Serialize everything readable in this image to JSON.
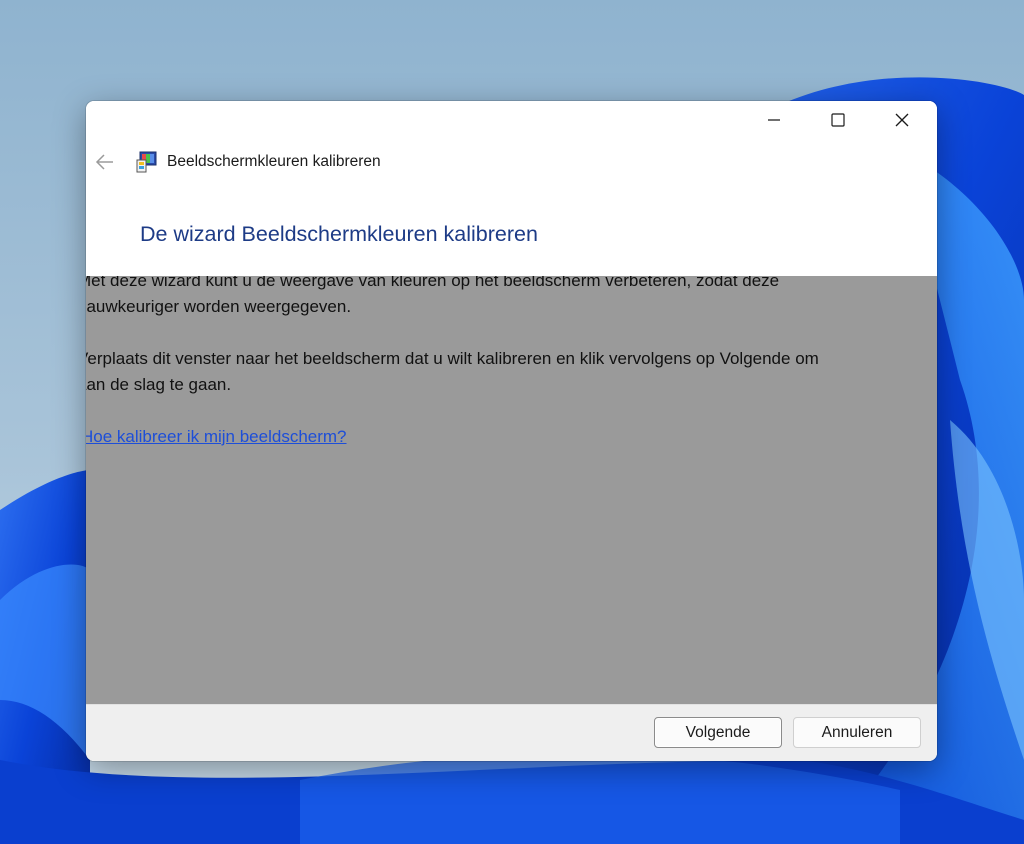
{
  "window": {
    "title": "Beeldschermkleuren kalibreren",
    "caption_buttons": [
      "minimize-icon",
      "maximize-icon",
      "close-icon"
    ],
    "back_icon": "back-arrow-icon",
    "app_icon": "display-color-calibration-icon"
  },
  "wizard": {
    "heading": "De wizard Beeldschermkleuren kalibreren",
    "paragraph1_line1": "Met deze wizard kunt u de weergave van kleuren op het beeldscherm verbeteren, zodat deze",
    "paragraph1_line2": "nauwkeuriger worden weergegeven.",
    "paragraph2_line1": "Verplaats dit venster naar het beeldscherm dat u wilt kalibreren en klik vervolgens op Volgende om",
    "paragraph2_line2": "aan de slag te gaan.",
    "help_link": "Hoe kalibreer ik mijn beeldscherm?"
  },
  "footer": {
    "next_label": "Volgende",
    "cancel_label": "Annuleren"
  },
  "colors": {
    "heading": "#1d3b86",
    "content_gray": "#9a9a9a",
    "link": "#1d4ed8"
  }
}
